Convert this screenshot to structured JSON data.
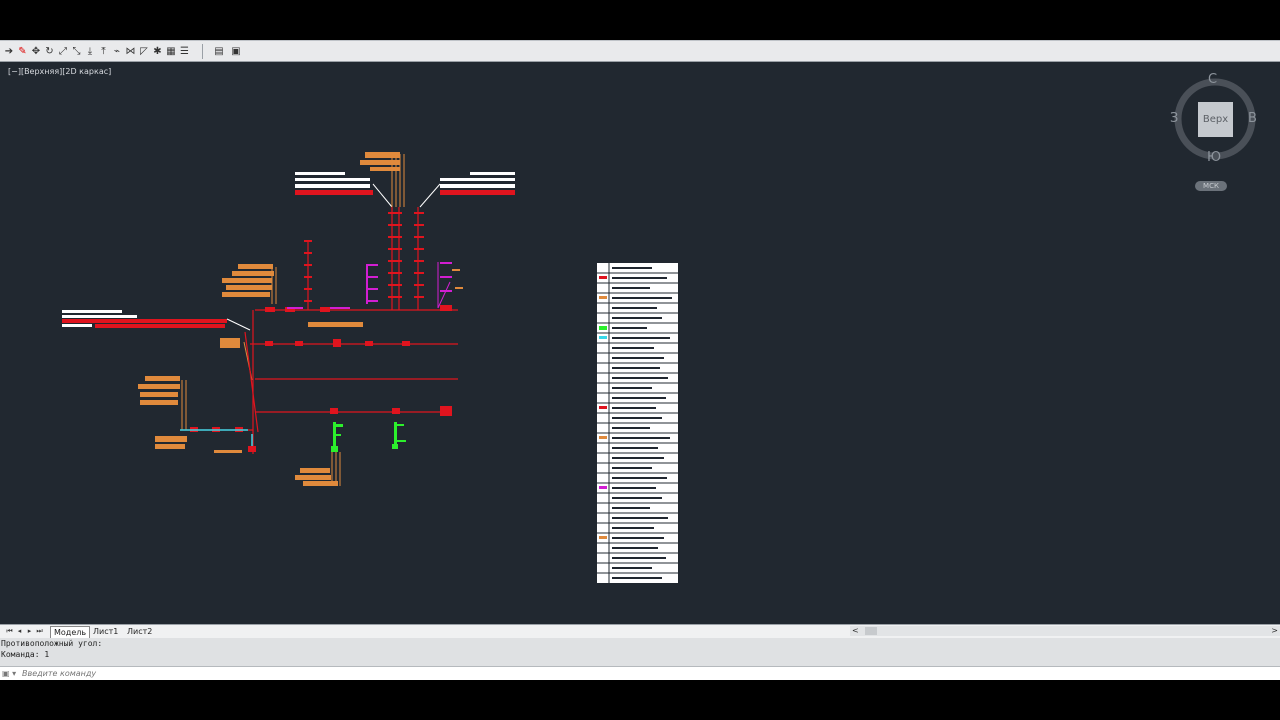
{
  "toolbar": {
    "buttons": [
      {
        "name": "arrow-icon",
        "glyph": "➔"
      },
      {
        "name": "erase-icon",
        "glyph": "✎"
      },
      {
        "name": "move-icon",
        "glyph": "✥"
      },
      {
        "name": "rotate-icon",
        "glyph": "↻"
      },
      {
        "name": "scale-icon",
        "glyph": "⤢"
      },
      {
        "name": "stretch-icon",
        "glyph": "⤡"
      },
      {
        "name": "trim-icon",
        "glyph": "⤓"
      },
      {
        "name": "extend-icon",
        "glyph": "⤒"
      },
      {
        "name": "break-icon",
        "glyph": "⌁"
      },
      {
        "name": "join-icon",
        "glyph": "⋈"
      },
      {
        "name": "chamfer-icon",
        "glyph": "◸"
      },
      {
        "name": "explode-icon",
        "glyph": "✱"
      },
      {
        "name": "layers-icon",
        "glyph": "▦"
      },
      {
        "name": "properties-icon",
        "glyph": "☰"
      },
      {
        "name": "table-icon",
        "glyph": "▤"
      },
      {
        "name": "layout-icon",
        "glyph": "▣"
      }
    ]
  },
  "viewport": {
    "label": "[−][Верхняя][2D каркас]",
    "background": "#212830"
  },
  "viewcube": {
    "north": "С",
    "south": "Ю",
    "west": "З",
    "east": "В",
    "face": "Верх",
    "ucs": "МСК"
  },
  "tabs": {
    "items": [
      "Модель",
      "Лист1",
      "Лист2"
    ],
    "active": "Модель"
  },
  "command": {
    "history": [
      "Противоположный угол:",
      "Команда: 1"
    ],
    "placeholder": "Введите команду"
  },
  "colors": {
    "pipe": "#e0141e",
    "label": "#e08a3c",
    "magenta": "#d21ed2",
    "green": "#2cf02c",
    "cyan": "#38d8e8",
    "white": "#ffffff"
  }
}
